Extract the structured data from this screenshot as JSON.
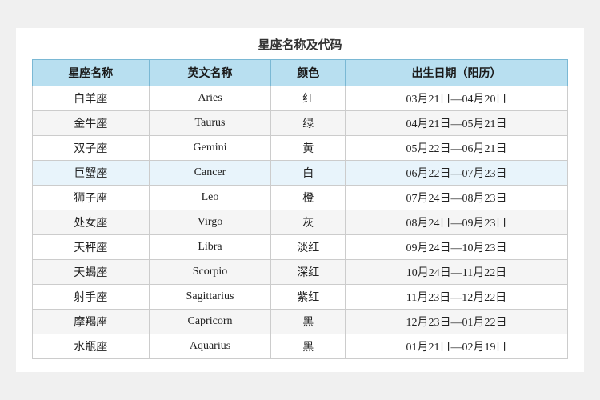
{
  "page": {
    "title": "星座名称及代码"
  },
  "table": {
    "headers": [
      "星座名称",
      "英文名称",
      "颜色",
      "出生日期（阳历）"
    ],
    "rows": [
      {
        "chinese": "白羊座",
        "english": "Aries",
        "color": "红",
        "dates": "03月21日—04月20日",
        "highlight": false
      },
      {
        "chinese": "金牛座",
        "english": "Taurus",
        "color": "绿",
        "dates": "04月21日—05月21日",
        "highlight": false
      },
      {
        "chinese": "双子座",
        "english": "Gemini",
        "color": "黄",
        "dates": "05月22日—06月21日",
        "highlight": false
      },
      {
        "chinese": "巨蟹座",
        "english": "Cancer",
        "color": "白",
        "dates": "06月22日—07月23日",
        "highlight": true
      },
      {
        "chinese": "狮子座",
        "english": "Leo",
        "color": "橙",
        "dates": "07月24日—08月23日",
        "highlight": false
      },
      {
        "chinese": "处女座",
        "english": "Virgo",
        "color": "灰",
        "dates": "08月24日—09月23日",
        "highlight": false
      },
      {
        "chinese": "天秤座",
        "english": "Libra",
        "color": "淡红",
        "dates": "09月24日—10月23日",
        "highlight": false
      },
      {
        "chinese": "天蝎座",
        "english": "Scorpio",
        "color": "深红",
        "dates": "10月24日—11月22日",
        "highlight": false
      },
      {
        "chinese": "射手座",
        "english": "Sagittarius",
        "color": "紫红",
        "dates": "11月23日—12月22日",
        "highlight": false
      },
      {
        "chinese": "摩羯座",
        "english": "Capricorn",
        "color": "黑",
        "dates": "12月23日—01月22日",
        "highlight": false
      },
      {
        "chinese": "水瓶座",
        "english": "Aquarius",
        "color": "黑",
        "dates": "01月21日—02月19日",
        "highlight": false
      }
    ]
  }
}
